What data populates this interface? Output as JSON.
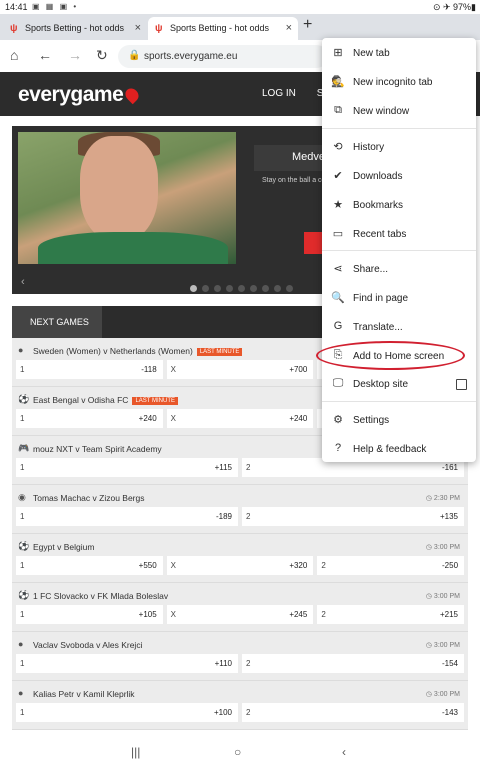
{
  "status": {
    "time": "14:41",
    "icons": "▣ ▦ ▣ •",
    "right": "⊙ ✈ 97%▮"
  },
  "tabs": [
    {
      "label": "Sports Betting - hot odds"
    },
    {
      "label": "Sports Betting - hot odds"
    }
  ],
  "urlbar": {
    "url": "sports.everygame.eu"
  },
  "site": {
    "logo": "everygame",
    "login": "LOG IN",
    "signup": "SIG"
  },
  "hero": {
    "badge": "Medve",
    "text": "Stay on the ball a continues. Wage",
    "arrow": "‹"
  },
  "games_tab": "NEXT GAMES",
  "games": [
    {
      "title": "Sweden (Women) v Netherlands (Women)",
      "badge": "LAST MINUTE",
      "time": "",
      "icon": "●",
      "odds": [
        {
          "lab": "1",
          "val": "-118"
        },
        {
          "lab": "X",
          "val": "+700"
        },
        {
          "lab": "",
          "val": ""
        }
      ]
    },
    {
      "title": "East Bengal v Odisha FC",
      "badge": "LAST MINUTE",
      "time": "",
      "icon": "⚽",
      "odds": [
        {
          "lab": "1",
          "val": "+240"
        },
        {
          "lab": "X",
          "val": "+240"
        },
        {
          "lab": "",
          "val": ""
        }
      ]
    },
    {
      "title": "mouz NXT v Team Spirit Academy",
      "badge": "",
      "time": "",
      "icon": "🎮",
      "odds": [
        {
          "lab": "1",
          "val": "+115"
        },
        {
          "lab": "2",
          "val": "-161"
        }
      ]
    },
    {
      "title": "Tomas Machac v Zizou Bergs",
      "badge": "",
      "time": "2:30 PM",
      "icon": "◉",
      "odds": [
        {
          "lab": "1",
          "val": "-189"
        },
        {
          "lab": "2",
          "val": "+135"
        }
      ]
    },
    {
      "title": "Egypt v Belgium",
      "badge": "",
      "time": "3:00 PM",
      "icon": "⚽",
      "odds": [
        {
          "lab": "1",
          "val": "+550"
        },
        {
          "lab": "X",
          "val": "+320"
        },
        {
          "lab": "2",
          "val": "-250"
        }
      ]
    },
    {
      "title": "1 FC Slovacko v FK Mlada Boleslav",
      "badge": "",
      "time": "3:00 PM",
      "icon": "⚽",
      "odds": [
        {
          "lab": "1",
          "val": "+105"
        },
        {
          "lab": "X",
          "val": "+245"
        },
        {
          "lab": "2",
          "val": "+215"
        }
      ]
    },
    {
      "title": "Vaclav Svoboda v Ales Krejci",
      "badge": "",
      "time": "3:00 PM",
      "icon": "●",
      "odds": [
        {
          "lab": "1",
          "val": "+110"
        },
        {
          "lab": "2",
          "val": "-154"
        }
      ]
    },
    {
      "title": "Kalias Petr v Kamil Kleprlik",
      "badge": "",
      "time": "3:00 PM",
      "icon": "●",
      "odds": [
        {
          "lab": "1",
          "val": "+100"
        },
        {
          "lab": "2",
          "val": "-143"
        }
      ]
    }
  ],
  "menu": {
    "new_tab": "New tab",
    "new_incognito_tab": "New incognito tab",
    "new_window": "New window",
    "history": "History",
    "downloads": "Downloads",
    "bookmarks": "Bookmarks",
    "recent_tabs": "Recent tabs",
    "share": "Share...",
    "find_in_page": "Find in page",
    "translate": "Translate...",
    "add_to_home_screen": "Add to Home screen",
    "desktop_site": "Desktop site",
    "settings": "Settings",
    "help_feedback": "Help & feedback"
  },
  "icons": {
    "new_tab": "⊞",
    "incognito": "🕵",
    "new_window": "⧉",
    "history": "⟲",
    "downloads": "✔",
    "bookmarks": "★",
    "recent_tabs": "▭",
    "share": "⋖",
    "find": "🔍",
    "translate": "G",
    "add_home": "⎘",
    "desktop": "🖵",
    "settings": "⚙",
    "help": "?"
  },
  "navbar": {
    "recents": "|||",
    "home": "○",
    "back": "‹"
  },
  "colors": {
    "accent_red": "#e02020",
    "header_bg": "#2c2c2c",
    "badge_orange": "#e8572a",
    "highlight": "#d12030"
  }
}
